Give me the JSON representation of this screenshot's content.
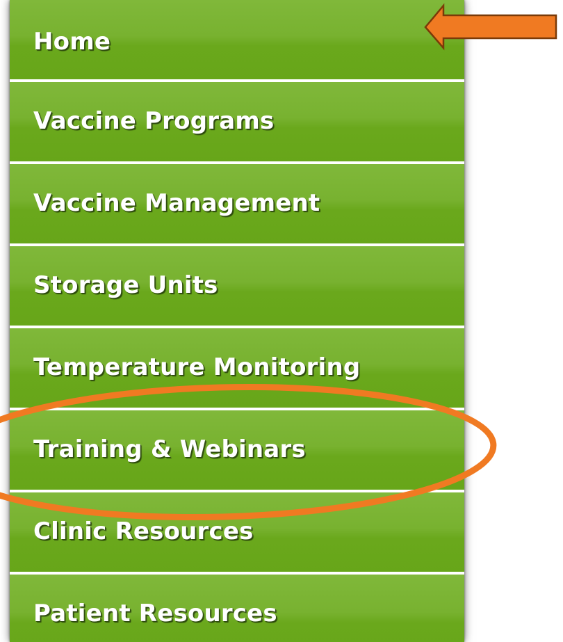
{
  "menu": {
    "items": [
      {
        "label": "Home"
      },
      {
        "label": "Vaccine Programs"
      },
      {
        "label": "Vaccine Management"
      },
      {
        "label": "Storage Units"
      },
      {
        "label": "Temperature Monitoring"
      },
      {
        "label": "Training & Webinars"
      },
      {
        "label": "Clinic Resources"
      },
      {
        "label": "Patient Resources"
      }
    ]
  },
  "annotations": {
    "arrow": {
      "target": "Home",
      "color": "#f07a22"
    },
    "circle": {
      "target": "Training & Webinars",
      "color": "#f07a22"
    }
  },
  "colors": {
    "menu_green": "#6aa81c",
    "menu_green_light": "#80b83a",
    "separator": "#ffffff",
    "label_text": "#ffffff"
  }
}
